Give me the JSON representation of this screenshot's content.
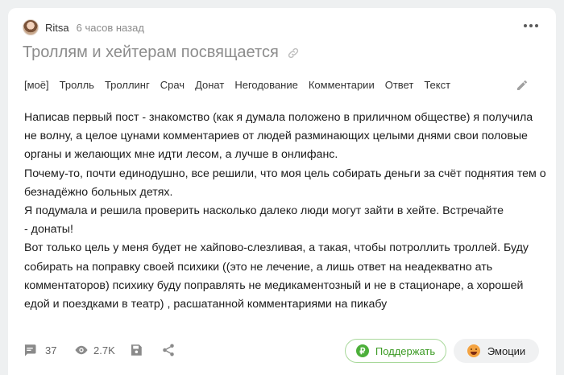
{
  "post": {
    "author": "Ritsa",
    "time": "6 часов назад",
    "title": "Троллям и хейтерам посвящается"
  },
  "tags": [
    "[моё]",
    "Тролль",
    "Троллинг",
    "Срач",
    "Донат",
    "Негодование",
    "Комментарии",
    "Ответ",
    "Текст"
  ],
  "body": [
    "Написав первый пост - знакомство (как я думала положено в приличном обществе) я получила",
    "не волну, а целое цунами комментариев от людей разминающих целыми днями свои половые",
    "органы и желающих мне идти лесом, а лучше в онлифанс.",
    "Почему-то, почти единодушно, все решили, что моя цель собирать деньги за счёт поднятия тем о",
    "безнадёжно больных детях.",
    "Я подумала и решила проверить насколько далеко люди могут зайти в хейте. Встречайте",
    "- донаты!",
    "Вот только цель у меня будет не хайпово-слезливая, а такая, чтобы потроллить троллей. Буду",
    "собирать на поправку своей психики ((это не лечение, а лишь ответ на неадекватно ать",
    "комментаторов) психику буду поправлять не медикаментозный и не в стационаре, а хорошей",
    "едой и поездками в театр) , расшатанной комментариями на пикабу"
  ],
  "footer": {
    "comments_count": "37",
    "views_count": "2.7K",
    "support_label": "Поддержать",
    "support_symbol": "₽",
    "emotions_label": "Эмоции"
  },
  "colors": {
    "support_green": "#3c9b25",
    "title_gray": "#8c8c8c"
  }
}
